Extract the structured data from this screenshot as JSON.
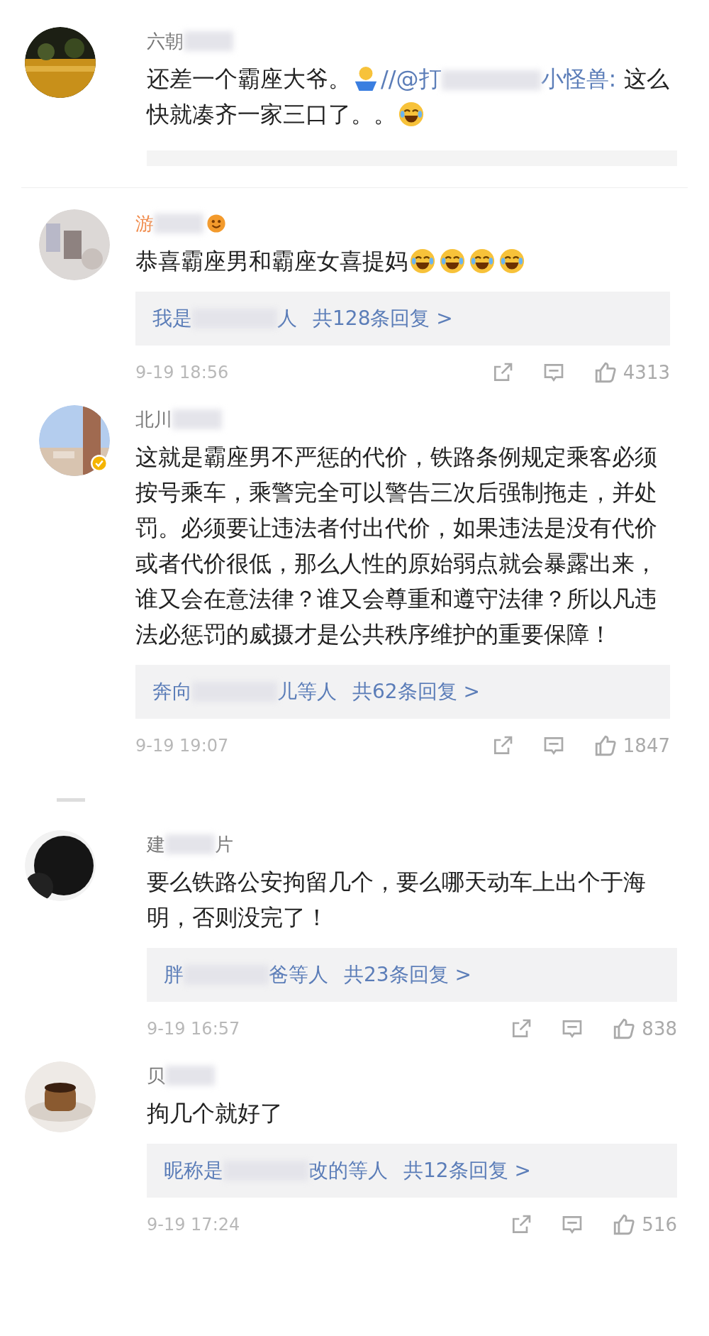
{
  "comments": [
    {
      "nested": false,
      "vip": false,
      "badge": false,
      "verified": false,
      "name": [
        "六朝"
      ],
      "segments": [
        {
          "kind": "text",
          "text": "还差一个霸座大爷。"
        },
        {
          "kind": "emoji-figure"
        },
        {
          "kind": "link",
          "parts": [
            "//@打",
            "小怪兽:"
          ]
        },
        {
          "kind": "text",
          "text": " 这么快就凑齐一家三口了。。"
        },
        {
          "kind": "emoji-laugh"
        }
      ],
      "quote": true
    },
    {
      "nested": true,
      "vip": true,
      "badge": true,
      "verified": false,
      "name": [
        "游"
      ],
      "segments": [
        {
          "kind": "text",
          "text": "恭喜霸座男和霸座女喜提妈"
        },
        {
          "kind": "emoji-laugh"
        },
        {
          "kind": "emoji-laugh"
        },
        {
          "kind": "emoji-laugh"
        },
        {
          "kind": "emoji-laugh"
        }
      ],
      "quote": false,
      "replies": {
        "prefix": "我是",
        "suffix": "人",
        "total": "共128条回复 >"
      },
      "time": "9-19 18:56",
      "likes": "4313"
    },
    {
      "nested": true,
      "vip": false,
      "badge": false,
      "verified": true,
      "name": [
        "北川"
      ],
      "segments": [
        {
          "kind": "text",
          "text": "这就是霸座男不严惩的代价，铁路条例规定乘客必须按号乘车，乘警完全可以警告三次后强制拖走，并处罚。必须要让违法者付出代价，如果违法是没有代价或者代价很低，那么人性的原始弱点就会暴露出来，谁又会在意法律？谁又会尊重和遵守法律？所以凡违法必惩罚的威摄才是公共秩序维护的重要保障！"
        }
      ],
      "quote": false,
      "replies": {
        "prefix": "奔向",
        "suffix": "儿等人",
        "total": "共62条回复 >"
      },
      "time": "9-19 19:07",
      "likes": "1847"
    },
    {
      "nested": false,
      "vip": false,
      "badge": false,
      "verified": false,
      "name": [
        "建",
        "片"
      ],
      "segments": [
        {
          "kind": "text",
          "text": "要么铁路公安拘留几个，要么哪天动车上出个于海明，否则没完了！"
        }
      ],
      "quote": false,
      "replies": {
        "prefix": "胖",
        "suffix": "爸等人",
        "total": "共23条回复 >"
      },
      "time": "9-19 16:57",
      "likes": "838"
    },
    {
      "nested": false,
      "vip": false,
      "badge": false,
      "verified": false,
      "name": [
        "贝"
      ],
      "segments": [
        {
          "kind": "text",
          "text": "拘几个就好了"
        }
      ],
      "quote": false,
      "replies": {
        "prefix": "昵称是",
        "suffix": "改的等人",
        "total": "共12条回复 >"
      },
      "time": "9-19 17:24",
      "likes": "516"
    }
  ]
}
